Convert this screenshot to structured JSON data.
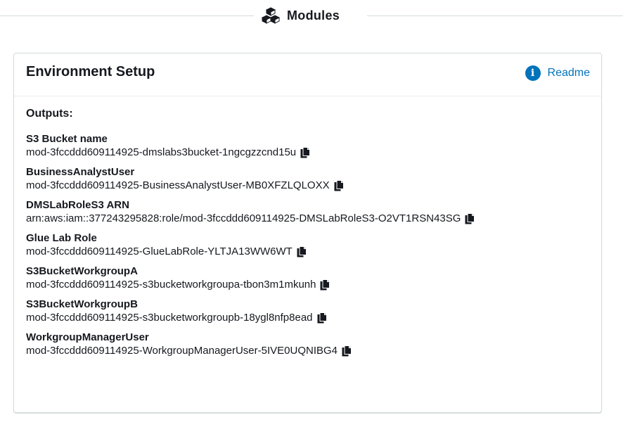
{
  "section": {
    "title": "Modules",
    "icon": "cubes-icon"
  },
  "card": {
    "title": "Environment Setup",
    "readme_label": "Readme",
    "readme_icon": "info-icon",
    "info_glyph": "i",
    "outputs_label": "Outputs:",
    "outputs": [
      {
        "name": "S3 Bucket name",
        "value": "mod-3fccddd609114925-dmslabs3bucket-1ngcgzzcnd15u"
      },
      {
        "name": "BusinessAnalystUser",
        "value": "mod-3fccddd609114925-BusinessAnalystUser-MB0XFZLQLOXX"
      },
      {
        "name": "DMSLabRoleS3 ARN",
        "value": "arn:aws:iam::377243295828:role/mod-3fccddd609114925-DMSLabRoleS3-O2VT1RSN43SG"
      },
      {
        "name": "Glue Lab Role",
        "value": "mod-3fccddd609114925-GlueLabRole-YLTJA13WW6WT"
      },
      {
        "name": "S3BucketWorkgroupA",
        "value": "mod-3fccddd609114925-s3bucketworkgroupa-tbon3m1mkunh"
      },
      {
        "name": "S3BucketWorkgroupB",
        "value": "mod-3fccddd609114925-s3bucketworkgroupb-18ygl8nfp8ead"
      },
      {
        "name": "WorkgroupManagerUser",
        "value": "mod-3fccddd609114925-WorkgroupManagerUser-5IVE0UQNIBG4"
      }
    ]
  },
  "colors": {
    "link": "#0073bb",
    "text": "#16191f",
    "border": "#d5dbdb"
  }
}
